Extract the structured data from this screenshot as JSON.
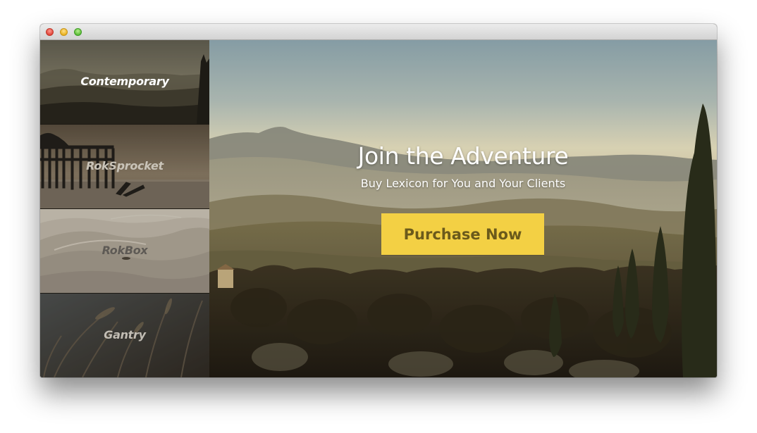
{
  "sidebar": {
    "items": [
      {
        "label": "Contemporary",
        "color": "#ffffff"
      },
      {
        "label": "RokSprocket",
        "color": "#c9c3b8"
      },
      {
        "label": "RokBox",
        "color": "#5e5a55"
      },
      {
        "label": "Gantry",
        "color": "#c2bdb4"
      }
    ]
  },
  "hero": {
    "title": "Join the Adventure",
    "subtitle": "Buy Lexicon for You and Your Clients",
    "cta_label": "Purchase Now",
    "cta_color": "#f3d044"
  }
}
